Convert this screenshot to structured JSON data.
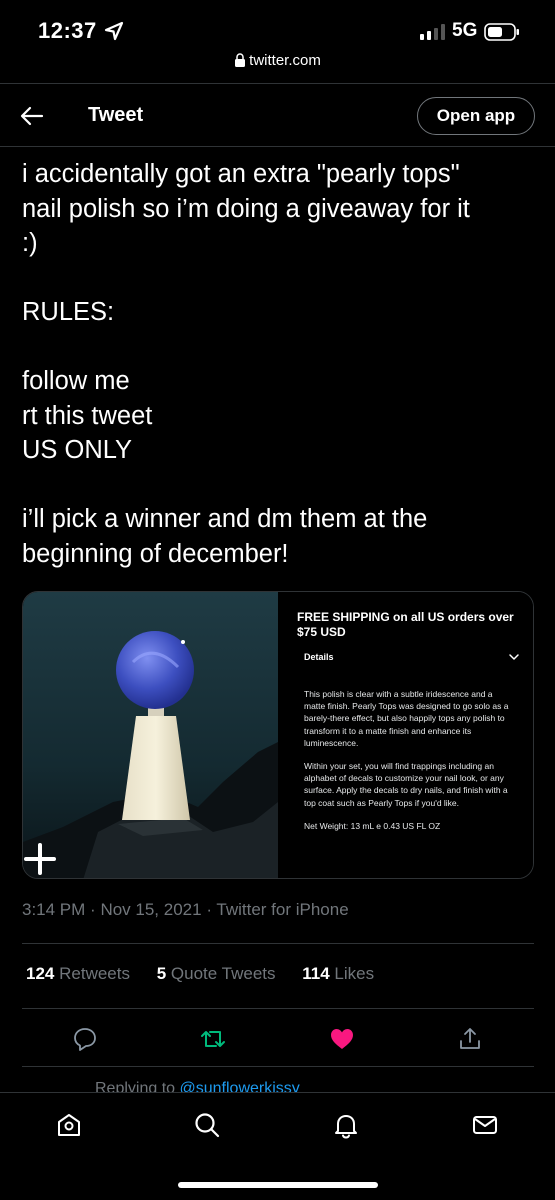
{
  "status_bar": {
    "time": "12:37",
    "network": "5G",
    "icons": [
      "location-arrow-icon",
      "signal-bars-icon",
      "battery-icon"
    ]
  },
  "browser": {
    "url": "twitter.com",
    "lock_icon": "lock-icon"
  },
  "header": {
    "back_icon": "back-arrow-icon",
    "title": "Tweet",
    "open_app_label": "Open app"
  },
  "tweet": {
    "text": "i accidentally got an extra \"pearly tops\"\nnail polish so i’m doing a giveaway for it\n:)\n\nRULES:\n\nfollow me\nrt this tweet\nUS ONLY\n\ni’ll pick a winner and dm them at the\nbeginning of december!",
    "media": {
      "shipping_text": "FREE SHIPPING on all US orders over $75 USD",
      "details_label": "Details",
      "description_1": "This polish is clear with a subtle iridescence and a matte finish. Pearly Tops was designed to go solo as a barely-there effect, but also happily tops any polish to transform it to a matte finish and enhance its luminescence.",
      "description_2": "Within your set, you will find trappings including an alphabet of decals to customize your nail look, or any surface. Apply the decals to dry nails, and finish with a top coat such as Pearly Tops if you'd like.",
      "net_weight": "Net Weight: 13 mL e 0.43 US FL OZ"
    },
    "time": "3:14 PM",
    "date": "Nov 15, 2021",
    "source": "Twitter for iPhone",
    "stats": {
      "retweets_count": "124",
      "retweets_label": "Retweets",
      "quotes_count": "5",
      "quotes_label": "Quote Tweets",
      "likes_count": "114",
      "likes_label": "Likes"
    },
    "actions": [
      "reply-icon",
      "retweet-icon",
      "like-icon",
      "share-icon"
    ],
    "like_color": "#f91880",
    "retweet_color": "#00ba7c"
  },
  "replying": {
    "prefix": "Replying to",
    "handle": "@sunflowerkissy"
  },
  "bottom_nav": [
    "home-icon",
    "search-icon",
    "notifications-icon",
    "messages-icon"
  ]
}
